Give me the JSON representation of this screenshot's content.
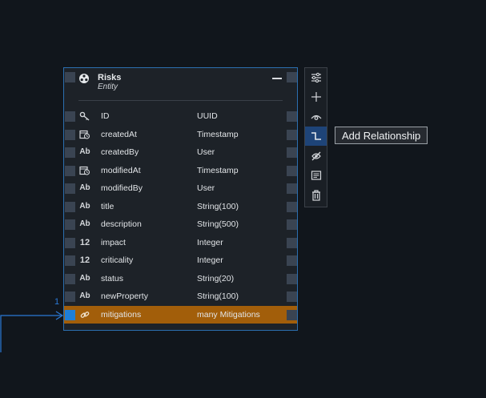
{
  "entity": {
    "title": "Risks",
    "subtitle": "Entity",
    "properties": [
      {
        "name": "ID",
        "type": "UUID",
        "icon": "key-icon",
        "glyph": ""
      },
      {
        "name": "createdAt",
        "type": "Timestamp",
        "icon": "calendar-clock-icon",
        "glyph": ""
      },
      {
        "name": "createdBy",
        "type": "User",
        "icon": "text-type-icon",
        "glyph": "Ab"
      },
      {
        "name": "modifiedAt",
        "type": "Timestamp",
        "icon": "calendar-clock-icon",
        "glyph": ""
      },
      {
        "name": "modifiedBy",
        "type": "User",
        "icon": "text-type-icon",
        "glyph": "Ab"
      },
      {
        "name": "title",
        "type": "String(100)",
        "icon": "text-type-icon",
        "glyph": "Ab"
      },
      {
        "name": "description",
        "type": "String(500)",
        "icon": "text-type-icon",
        "glyph": "Ab"
      },
      {
        "name": "impact",
        "type": "Integer",
        "icon": "number-type-icon",
        "glyph": "12"
      },
      {
        "name": "criticality",
        "type": "Integer",
        "icon": "number-type-icon",
        "glyph": "12"
      },
      {
        "name": "status",
        "type": "String(20)",
        "icon": "text-type-icon",
        "glyph": "Ab"
      },
      {
        "name": "newProperty",
        "type": "String(100)",
        "icon": "text-type-icon",
        "glyph": "Ab"
      },
      {
        "name": "mitigations",
        "type": "many Mitigations",
        "icon": "link-icon",
        "glyph": "",
        "selected": true
      }
    ]
  },
  "toolbar": {
    "items": [
      {
        "icon": "properties-settings-icon"
      },
      {
        "icon": "add-icon"
      },
      {
        "icon": "view-icon"
      },
      {
        "icon": "add-relationship-icon",
        "active": true
      },
      {
        "icon": "hide-icon"
      },
      {
        "icon": "notes-icon"
      },
      {
        "icon": "delete-icon"
      }
    ],
    "tooltip": "Add Relationship"
  },
  "connection": {
    "cardinality": "1"
  },
  "colors": {
    "background": "#11161c",
    "entity_border": "#2b6fb0",
    "selected_row": "#a25e0a",
    "active_tool": "#1e4478",
    "connection": "#2b7ad6"
  }
}
